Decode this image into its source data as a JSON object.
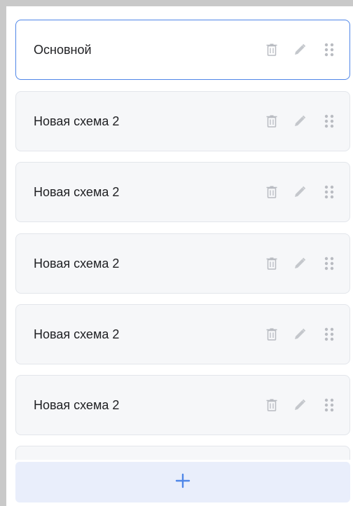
{
  "schemes": [
    {
      "label": "Основной",
      "selected": true
    },
    {
      "label": "Новая схема 2",
      "selected": false
    },
    {
      "label": "Новая схема 2",
      "selected": false
    },
    {
      "label": "Новая схема 2",
      "selected": false
    },
    {
      "label": "Новая схема 2",
      "selected": false
    },
    {
      "label": "Новая схема 2",
      "selected": false
    },
    {
      "label": "",
      "selected": false
    }
  ],
  "icons": {
    "delete": "trash-icon",
    "edit": "pencil-icon",
    "drag": "drag-handle-icon",
    "add": "plus-icon"
  },
  "colors": {
    "accent": "#4f86e8",
    "add_bar_bg": "#e9eefb",
    "item_bg": "#f6f7f9",
    "icon_gray": "#b9bcc2"
  }
}
